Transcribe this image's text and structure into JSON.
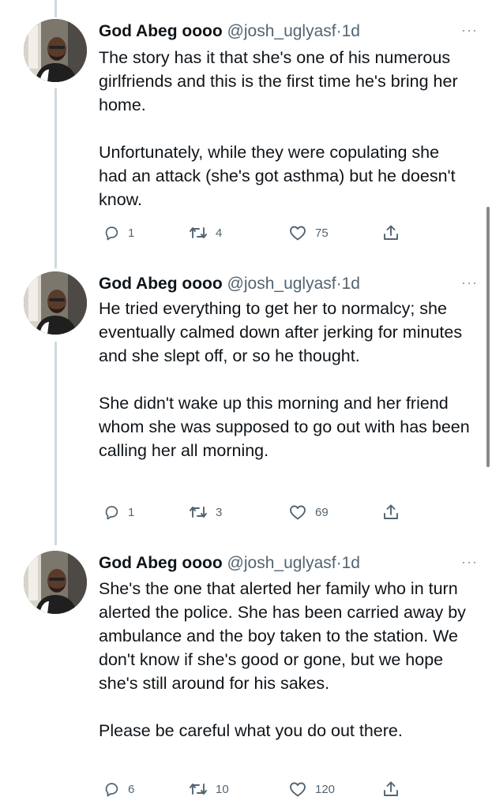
{
  "tweets": [
    {
      "name": "God Abeg oooo",
      "handle": "@josh_uglyasf",
      "separator": "·",
      "time": "1d",
      "more": "···",
      "paragraphs": [
        "The story has it that she's one of his numerous girlfriends and this is the first time he's bring her home.",
        "Unfortunately, while they were copulating she had an attack (she's got asthma) but he doesn't know."
      ],
      "replies": "1",
      "retweets": "4",
      "likes": "75"
    },
    {
      "name": "God Abeg oooo",
      "handle": "@josh_uglyasf",
      "separator": "·",
      "time": "1d",
      "more": "···",
      "paragraphs": [
        "He tried everything to get her to normalcy; she eventually calmed down after jerking for minutes and she slept off, or so he thought.",
        "She didn't wake up this morning and her friend whom she was supposed to go out with has been calling her all morning."
      ],
      "replies": "1",
      "retweets": "3",
      "likes": "69"
    },
    {
      "name": "God Abeg oooo",
      "handle": "@josh_uglyasf",
      "separator": "·",
      "time": "1d",
      "more": "···",
      "paragraphs": [
        "She's the one that alerted her family who in turn alerted the police. She has been carried away by ambulance and the boy taken to the station. We don't know if she's good or gone, but we hope she's still around for his sakes.",
        "Please be careful what you do out there."
      ],
      "replies": "6",
      "retweets": "10",
      "likes": "120"
    }
  ],
  "icons": {
    "reply": "reply-icon",
    "retweet": "retweet-icon",
    "like": "heart-icon",
    "share": "share-icon"
  }
}
